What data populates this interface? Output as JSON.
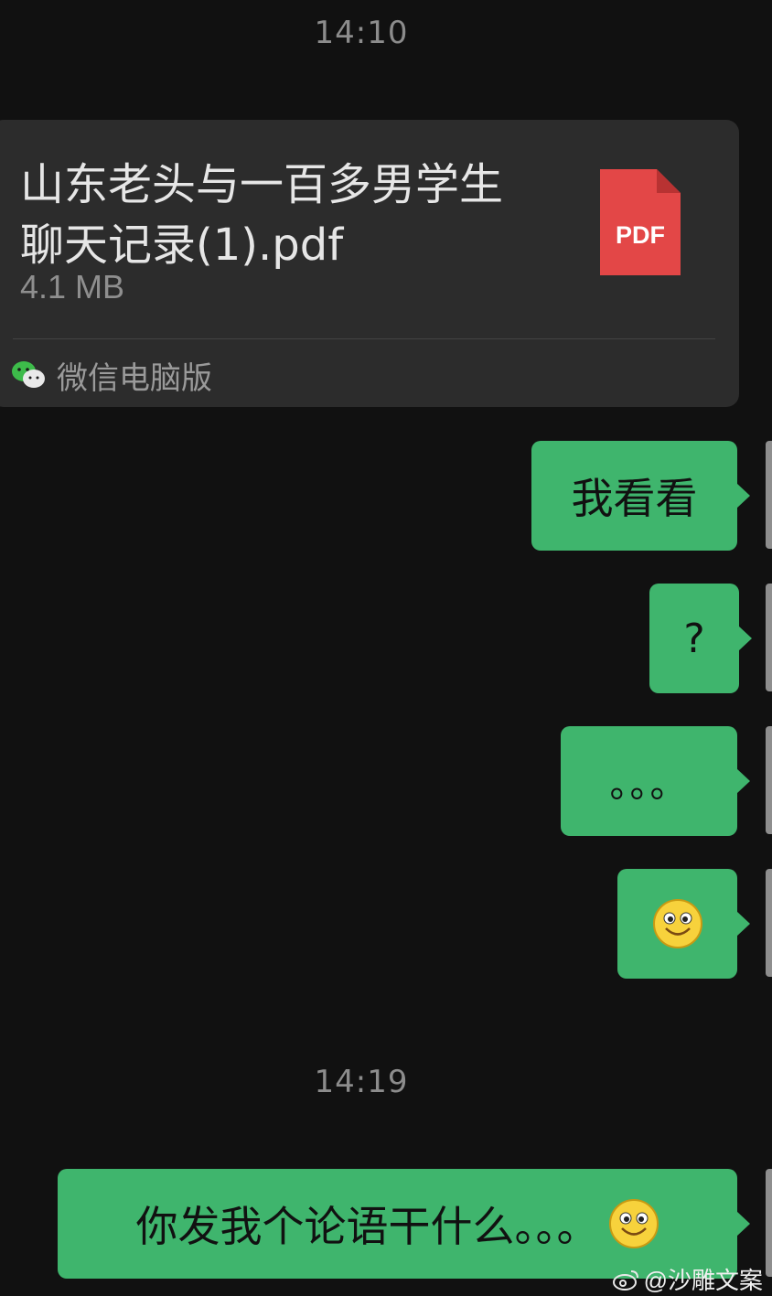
{
  "timestamps": [
    "14:10",
    "14:19"
  ],
  "file_message": {
    "title_line1": "山东老头与一百多男学生",
    "title_line2": "聊天记录(1).pdf",
    "size": "4.1 MB",
    "icon_label": "PDF",
    "source": "微信电脑版"
  },
  "messages": [
    {
      "text": "我看看"
    },
    {
      "text": "?"
    },
    {
      "text": "。。。"
    },
    {
      "emoji": "smiley-face"
    },
    {
      "text": "你发我个论语干什么。。。",
      "emoji": "smiley-face"
    }
  ],
  "watermark": "@沙雕文案",
  "colors": {
    "background": "#111111",
    "bubble_green": "#3fb56d",
    "card": "#2c2c2c",
    "pdf_red": "#e34747"
  }
}
